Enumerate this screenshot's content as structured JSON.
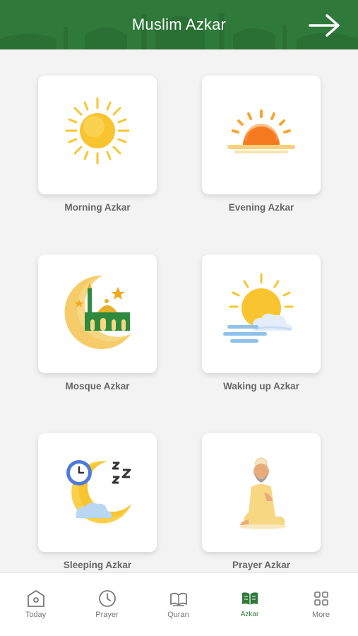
{
  "header": {
    "title": "Muslim Azkar",
    "next_icon": "arrow-right-icon"
  },
  "colors": {
    "header": "#2f7a3a",
    "accent": "#2f7a3a",
    "sun": "#f8c531",
    "text": "#666666"
  },
  "categories": [
    {
      "label": "Morning Azkar",
      "icon": "morning-sun-icon"
    },
    {
      "label": "Evening Azkar",
      "icon": "sunset-icon"
    },
    {
      "label": "Mosque Azkar",
      "icon": "crescent-mosque-icon"
    },
    {
      "label": "Waking up Azkar",
      "icon": "sun-cloud-icon"
    },
    {
      "label": "Sleeping Azkar",
      "icon": "moon-clock-zzz-icon"
    },
    {
      "label": "Prayer Azkar",
      "icon": "praying-man-icon"
    }
  ],
  "nav": {
    "items": [
      {
        "label": "Today",
        "icon": "home-icon"
      },
      {
        "label": "Prayer",
        "icon": "clock-icon"
      },
      {
        "label": "Quran",
        "icon": "quran-book-icon"
      },
      {
        "label": "Azkar",
        "icon": "azkar-book-icon",
        "active": true
      },
      {
        "label": "More",
        "icon": "grid-icon"
      }
    ]
  }
}
